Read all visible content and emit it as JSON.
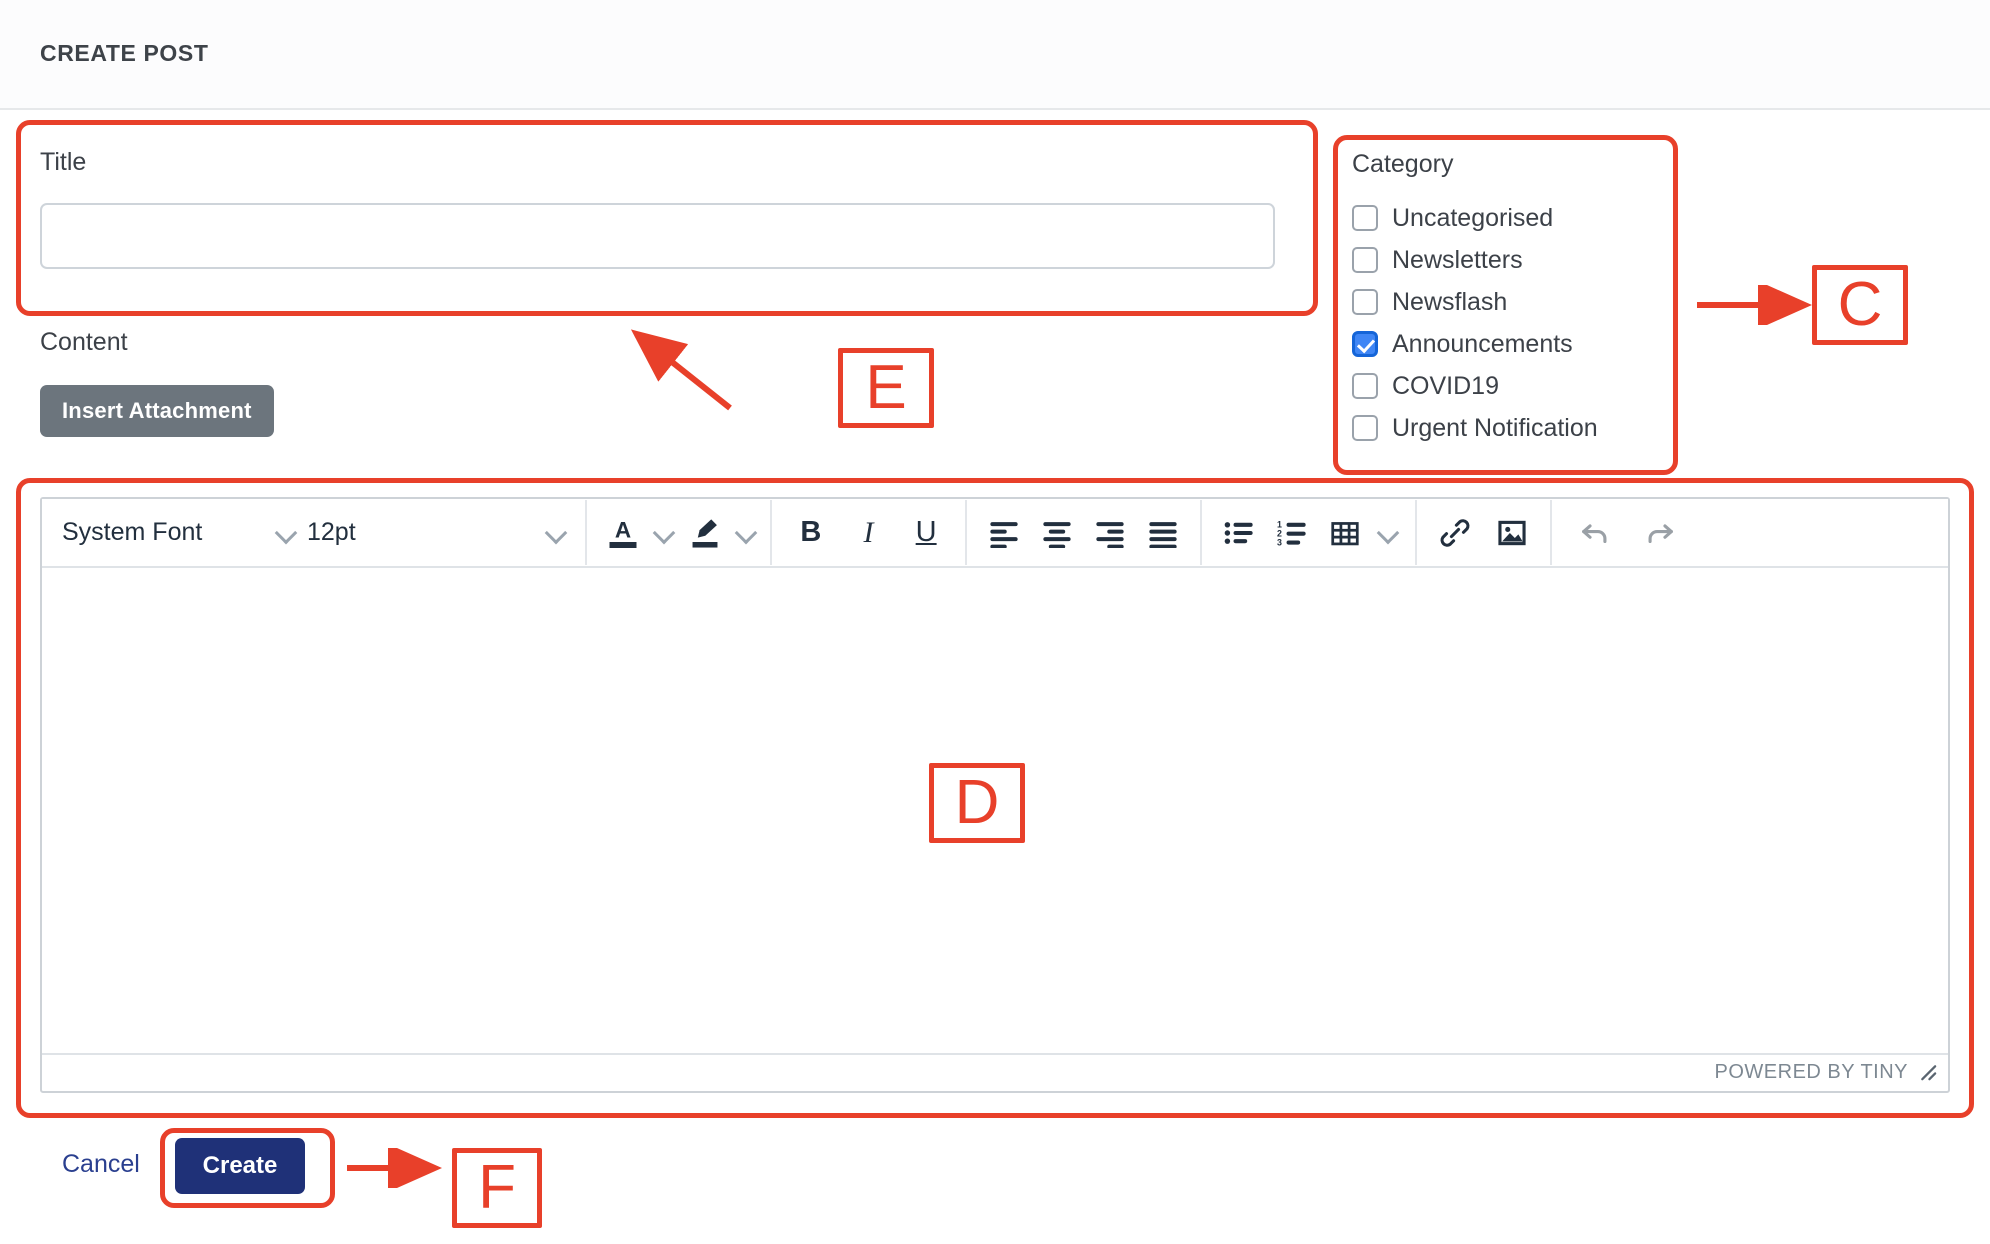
{
  "header": {
    "title": "CREATE POST"
  },
  "form": {
    "title_label": "Title",
    "title_value": "",
    "title_placeholder": "",
    "content_label": "Content",
    "insert_attachment_label": "Insert Attachment"
  },
  "category": {
    "title": "Category",
    "items": [
      {
        "label": "Uncategorised",
        "checked": false
      },
      {
        "label": "Newsletters",
        "checked": false
      },
      {
        "label": "Newsflash",
        "checked": false
      },
      {
        "label": "Announcements",
        "checked": true
      },
      {
        "label": "COVID19",
        "checked": false
      },
      {
        "label": "Urgent Notification",
        "checked": false
      }
    ]
  },
  "editor": {
    "font_family_value": "System Font",
    "font_size_value": "12pt",
    "body_text": "",
    "status_text": "POWERED BY TINY",
    "toolbar": {
      "text_color": "A",
      "bold": "B",
      "italic": "I",
      "underline": "U"
    }
  },
  "footer": {
    "cancel_label": "Cancel",
    "create_label": "Create"
  },
  "annotations": {
    "c": "C",
    "d": "D",
    "e": "E",
    "f": "F",
    "color": "#E8402A"
  },
  "colors": {
    "primary_button": "#1F3178",
    "secondary_button": "#6C757D",
    "checkbox_checked": "#3F86F5",
    "annotation": "#E8402A",
    "header_text": "#3E4349"
  }
}
